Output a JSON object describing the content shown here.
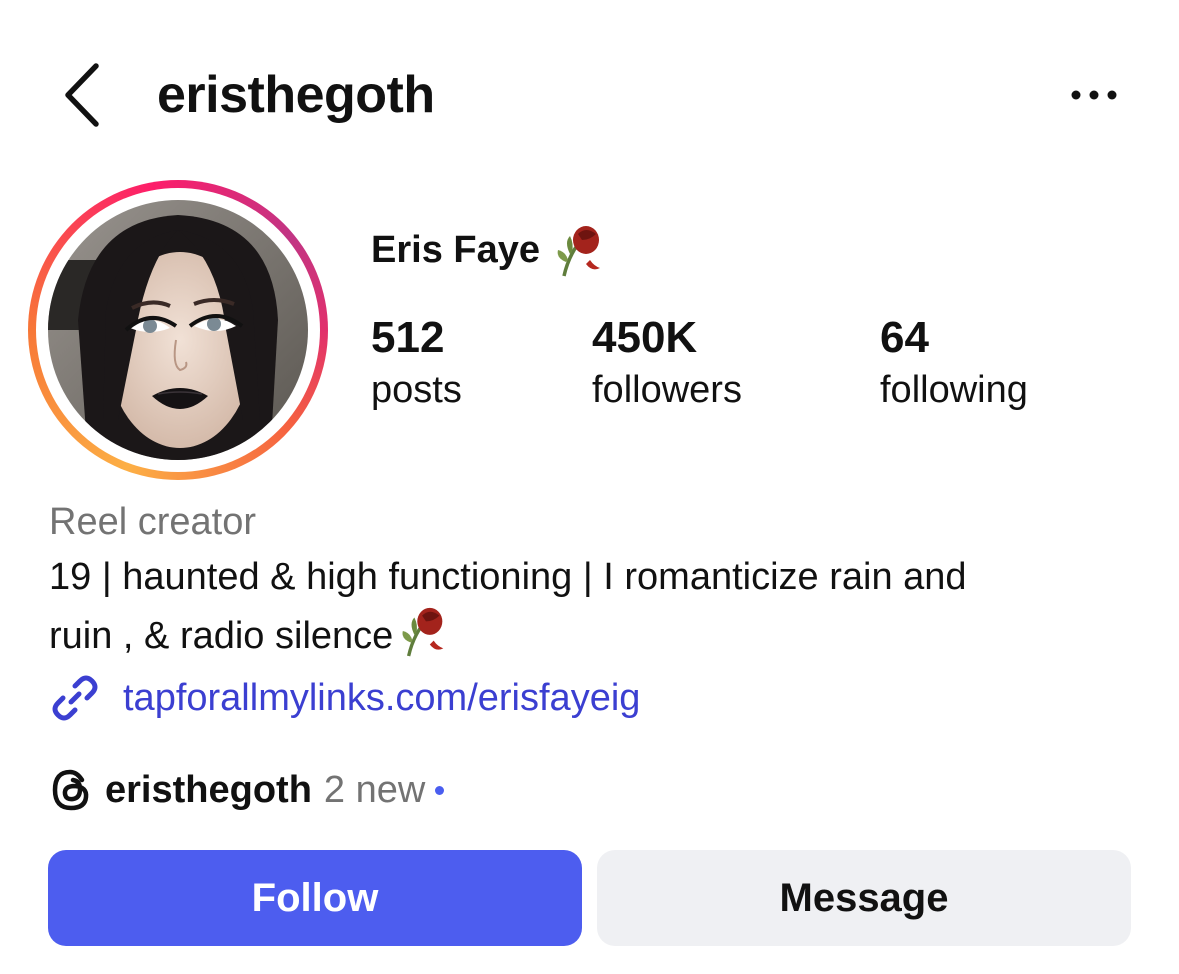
{
  "header": {
    "username": "eristhegoth",
    "back_icon": "chevron-left-icon",
    "more_icon": "ellipsis-icon"
  },
  "profile": {
    "display_name": "Eris Faye",
    "name_emoji": "wilted-rose-icon",
    "avatar": "profile-photo",
    "story_ring_colors": [
      "#fcaf45",
      "#f77737",
      "#fd1d6a",
      "#c13584"
    ]
  },
  "stats": [
    {
      "value": "512",
      "label": "posts"
    },
    {
      "value": "450K",
      "label": "followers"
    },
    {
      "value": "64",
      "label": "following"
    }
  ],
  "bio": {
    "category": "Reel creator",
    "line1": "19 | haunted & high functioning | I romanticize rain and",
    "line2": "ruin , & radio silence",
    "emoji": "wilted-rose-icon",
    "link": "tapforallmylinks.com/erisfayeig",
    "link_color": "#3b3fd1"
  },
  "threads": {
    "icon": "threads-icon",
    "username": "eristhegoth",
    "badge": "2 new",
    "dot_color": "#4a5ef0"
  },
  "actions": {
    "follow_label": "Follow",
    "message_label": "Message",
    "follow_color": "#4d5def",
    "message_color": "#eff0f3"
  }
}
